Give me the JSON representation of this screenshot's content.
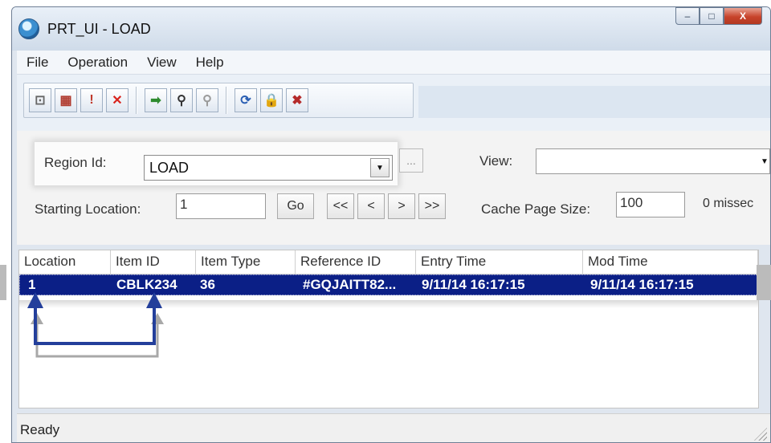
{
  "window": {
    "title": "PRT_UI - LOAD",
    "caption": {
      "minimize": "–",
      "maximize": "□",
      "close": "X"
    }
  },
  "menu": {
    "items": [
      "File",
      "Operation",
      "View",
      "Help"
    ]
  },
  "toolbar": {
    "buttons": [
      {
        "icon": "new-record-icon",
        "glyph": "⊡",
        "color": "#666666"
      },
      {
        "icon": "calendar-icon",
        "glyph": "▦",
        "color": "#b03a2e"
      },
      {
        "icon": "document-alert-icon",
        "glyph": "!",
        "color": "#c0392b"
      },
      {
        "icon": "delete-icon",
        "glyph": "✕",
        "color": "#d9231c"
      },
      {
        "icon": "go-arrow-icon",
        "glyph": "➡",
        "color": "#2e8b2e"
      },
      {
        "icon": "binoculars-icon",
        "glyph": "⚲",
        "color": "#333333"
      },
      {
        "icon": "binoculars-next-icon",
        "glyph": "⚲",
        "color": "#9a9a9a"
      },
      {
        "icon": "refresh-icon",
        "glyph": "⟳",
        "color": "#2b5fb3"
      },
      {
        "icon": "lock-icon",
        "glyph": "🔒",
        "color": "#d4a017"
      },
      {
        "icon": "delete-document-icon",
        "glyph": "✖",
        "color": "#b52a2a"
      }
    ]
  },
  "form": {
    "region_label": "Region Id:",
    "region_value": "LOAD",
    "ellipsis": "...",
    "view_label": "View:",
    "view_value": "",
    "starting_location_label": "Starting Location:",
    "starting_location_value": "1",
    "go_label": "Go",
    "nav": {
      "first": "<<",
      "prev": "<",
      "next": ">",
      "last": ">>"
    },
    "cache_label": "Cache Page Size:",
    "cache_value": "100",
    "missed_text": "0 missec"
  },
  "grid": {
    "columns": [
      "Location",
      "Item ID",
      "Item Type",
      "Reference ID",
      "Entry Time",
      "Mod Time"
    ],
    "rows": [
      [
        "1",
        "CBLK234",
        "36",
        "#GQJAITT82...",
        "9/11/14 16:17:15",
        "9/11/14 16:17:15"
      ]
    ]
  },
  "status": {
    "text": "Ready"
  },
  "colors": {
    "selection": "#0b1f86",
    "annotation_arrow": "#233f9b",
    "annotation_shadow": "#a8a8a8"
  }
}
